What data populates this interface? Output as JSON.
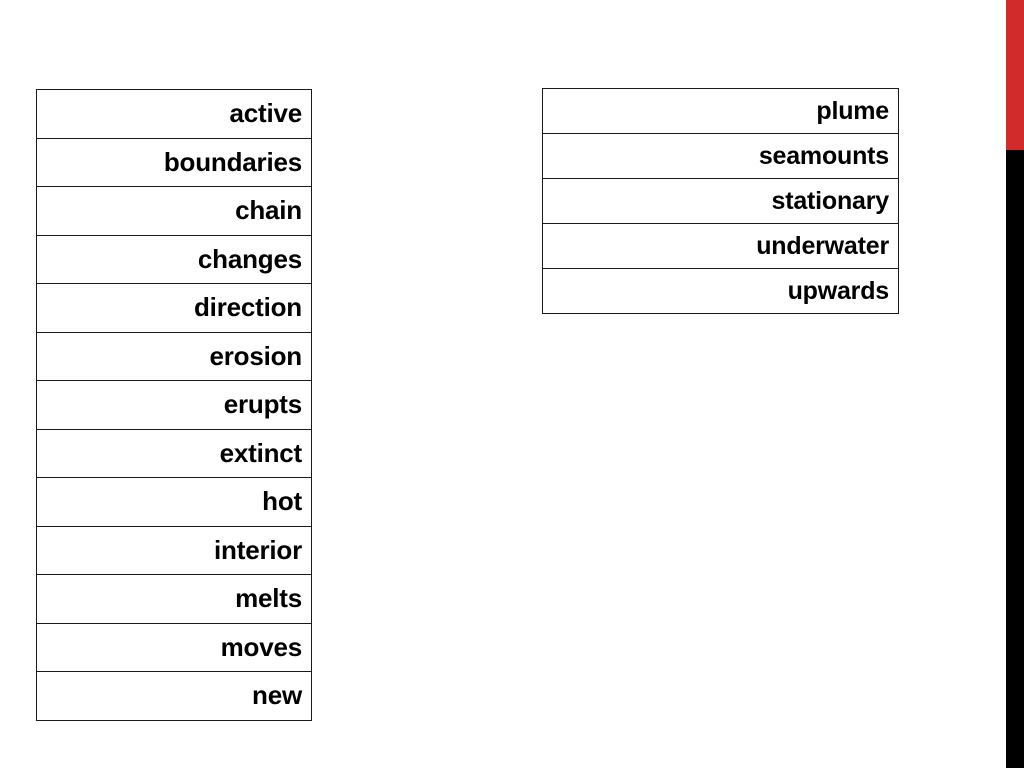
{
  "slide": {
    "background_color": "#ffffff",
    "accent_bar": {
      "red_color": "#d12b2b",
      "black_color": "#000000"
    }
  },
  "tables": {
    "left": {
      "name": "word-bank-column-one",
      "rows": [
        "active",
        "boundaries",
        "chain",
        "changes",
        "direction",
        "erosion",
        "erupts",
        "extinct",
        "hot",
        "interior",
        "melts",
        "moves",
        "new"
      ]
    },
    "right": {
      "name": "word-bank-column-two",
      "rows": [
        "plume",
        "seamounts",
        "stationary",
        "underwater",
        "upwards"
      ]
    }
  }
}
